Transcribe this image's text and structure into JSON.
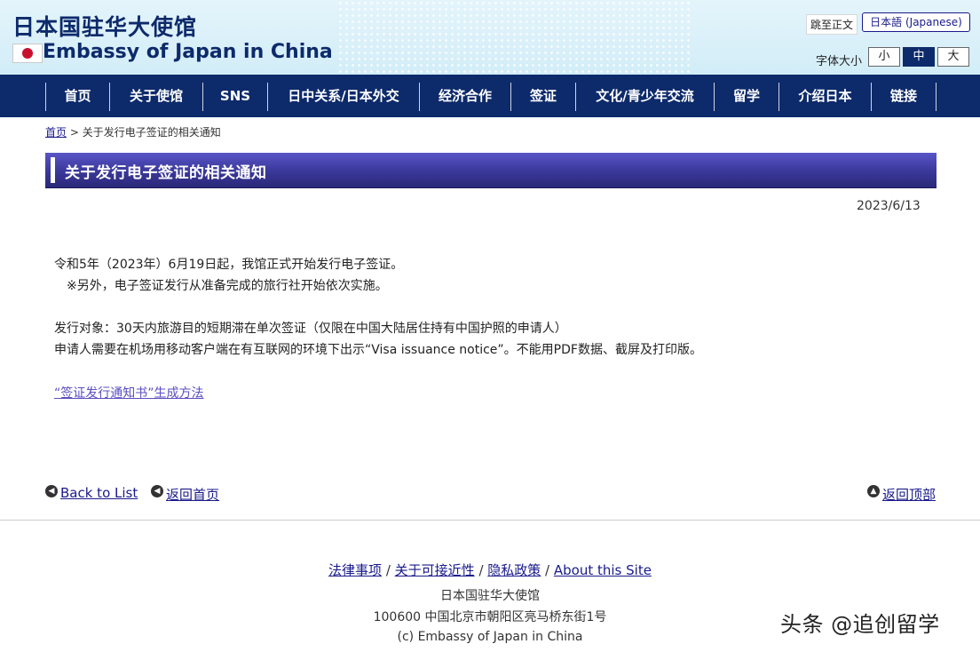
{
  "header": {
    "title_cn": "日本国驻华大使馆",
    "title_en": "Embassy of Japan in China",
    "skip_link": "跳至正文",
    "lang_link": "日本語 (Japanese)",
    "font_size_label": "字体大小",
    "font_sizes": [
      "小",
      "中",
      "大"
    ],
    "font_size_selected": "中"
  },
  "nav": {
    "items": [
      "首页",
      "关于使馆",
      "SNS",
      "日中关系/日本外交",
      "经济合作",
      "签证",
      "文化/青少年交流",
      "留学",
      "介绍日本",
      "链接"
    ]
  },
  "breadcrumb": {
    "home": "首页",
    "separator": " > ",
    "current": "关于发行电子签证的相关通知"
  },
  "page": {
    "title": "关于发行电子签证的相关通知",
    "date": "2023/6/13",
    "paragraphs": [
      "令和5年（2023年）6月19日起，我馆正式开始发行电子签证。",
      "　※另外，电子签证发行从准备完成的旅行社开始依次实施。",
      "发行对象：30天内旅游目的短期滞在单次签证（仅限在中国大陆居住持有中国护照的申请人）",
      "申请人需要在机场用移动客户端在有互联网的环境下出示“Visa issuance notice”。不能用PDF数据、截屏及打印版。"
    ],
    "guide_link": "“签证发行通知书”生成方法"
  },
  "bottom_nav": {
    "back_to_list": "Back to List",
    "back_home": "返回首页",
    "back_top": "返回顶部"
  },
  "footer": {
    "links": [
      "法律事项",
      "关于可接近性",
      "隐私政策",
      "About this Site"
    ],
    "link_separator": " / ",
    "name": "日本国驻华大使馆",
    "address": "100600 中国北京市朝阳区亮马桥东街1号",
    "copyright": "(c) Embassy of Japan in China"
  },
  "watermark": "头条 @追创留学",
  "colors": {
    "navy": "#0d2a6b",
    "title_bar": "#3c3a9c",
    "link": "#1a1a8c",
    "flag_red": "#c8102e"
  }
}
